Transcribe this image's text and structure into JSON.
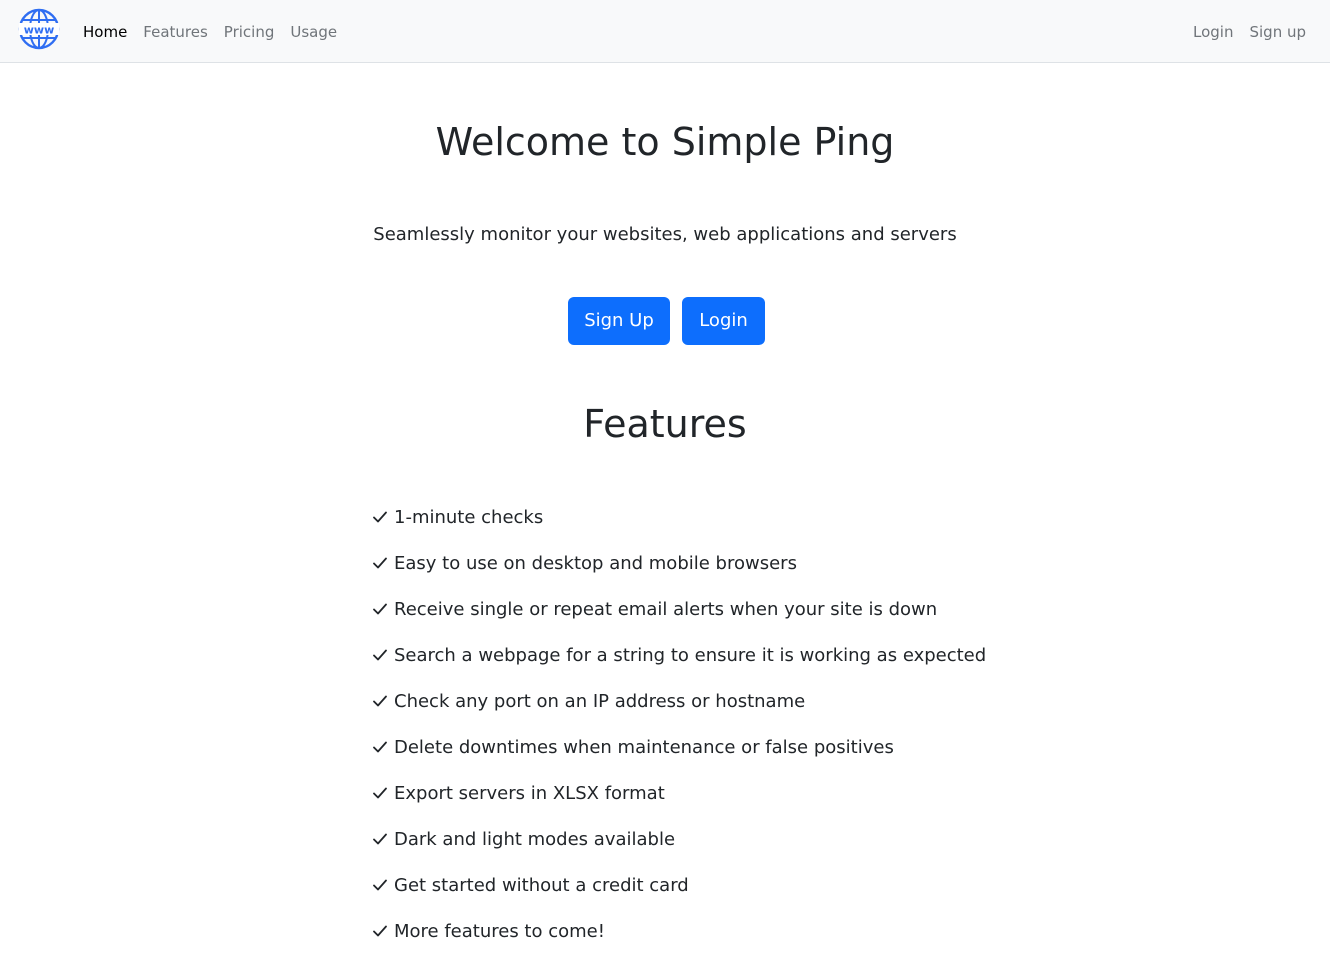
{
  "navbar": {
    "logo_icon": "globe-www-icon",
    "links": [
      {
        "label": "Home",
        "active": true
      },
      {
        "label": "Features",
        "active": false
      },
      {
        "label": "Pricing",
        "active": false
      },
      {
        "label": "Usage",
        "active": false
      }
    ],
    "right_links": [
      {
        "label": "Login"
      },
      {
        "label": "Sign up"
      }
    ]
  },
  "hero": {
    "title": "Welcome to Simple Ping",
    "lead": "Seamlessly monitor your websites, web applications and servers",
    "signup_label": "Sign Up",
    "login_label": "Login"
  },
  "features": {
    "title": "Features",
    "items": [
      "1-minute checks",
      "Easy to use on desktop and mobile browsers",
      "Receive single or repeat email alerts when your site is down",
      "Search a webpage for a string to ensure it is working as expected",
      "Check any port on an IP address or hostname",
      "Delete downtimes when maintenance or false positives",
      "Export servers in XLSX format",
      "Dark and light modes available",
      "Get started without a credit card",
      "More features to come!"
    ]
  },
  "colors": {
    "primary": "#0d6efd",
    "navbar_bg": "#f8f9fa",
    "text": "#212529",
    "nav_muted": "#70757a"
  }
}
